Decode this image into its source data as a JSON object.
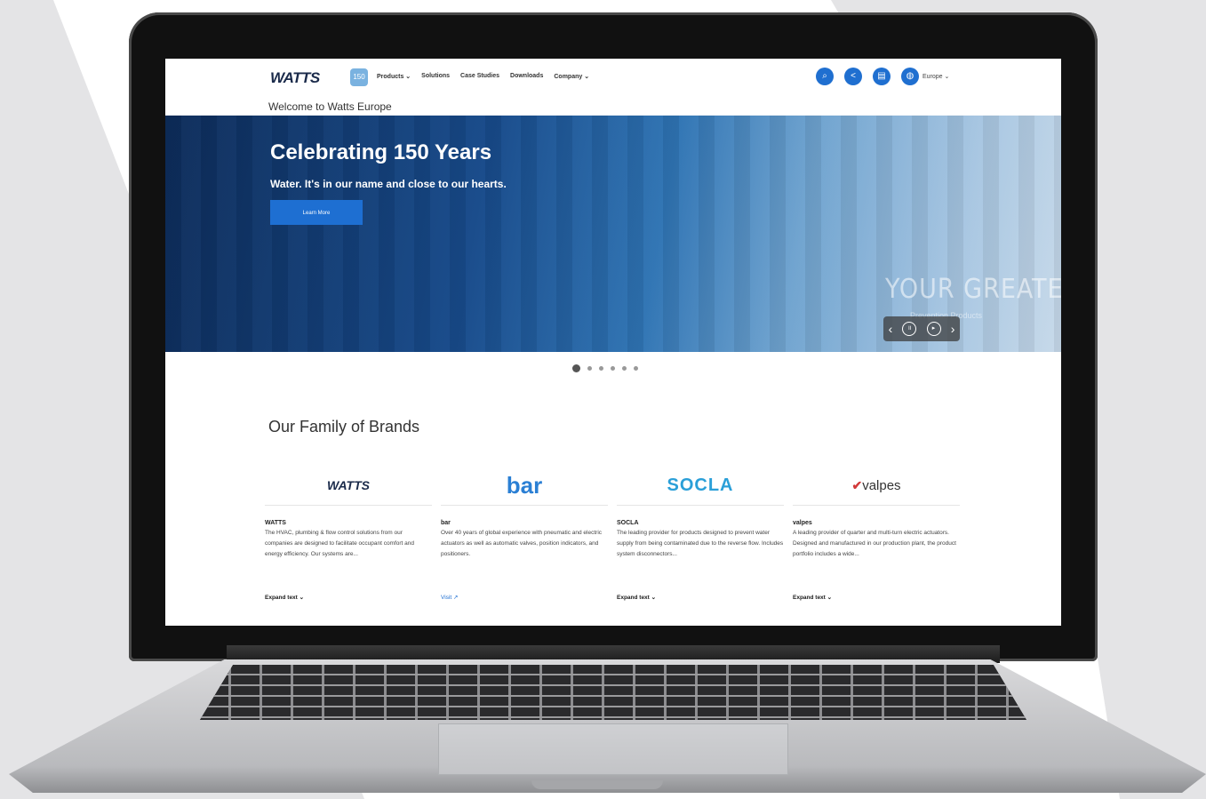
{
  "nav": {
    "logo": "WATTS",
    "logo_badge": "150",
    "menu": [
      "Products ⌄",
      "Solutions",
      "Case Studies",
      "Downloads",
      "Company ⌄"
    ],
    "region": "Europe ⌄"
  },
  "welcome": "Welcome to Watts Europe",
  "hero": {
    "title": "Celebrating 150 Years",
    "subtitle": "Water. It's in our name and close to our hearts.",
    "button": "Learn More",
    "poster_text": "YOUR GREATES",
    "poster_sub": "Prevention Products"
  },
  "section_title": "Our Family of Brands",
  "brands": [
    {
      "logo": "WATTS",
      "name": "WATTS",
      "desc": "The HVAC, plumbing & flow control solutions from our companies are designed to facilitate occupant comfort and energy efficiency. Our systems are...",
      "link": "Expand text ⌄"
    },
    {
      "logo": "bar",
      "name": "bar",
      "desc": "Over 40 years of global experience with pneumatic and electric actuators as well as automatic valves, position indicators, and positioners.",
      "link": "Visit ↗"
    },
    {
      "logo": "SOCLA",
      "name": "SOCLA",
      "desc": "The leading provider for products designed to prevent water supply from being contaminated due to the reverse flow. Includes system disconnectors...",
      "link": "Expand text ⌄"
    },
    {
      "logo": "valpes",
      "name": "valpes",
      "desc": "A leading provider of quarter and multi-turn electric actuators. Designed and manufactured in our production plant, the product portfolio includes a wide...",
      "link": "Expand text ⌄"
    }
  ],
  "colors": {
    "accent": "#1e6fd2",
    "brand_navy": "#1a2a4a"
  }
}
